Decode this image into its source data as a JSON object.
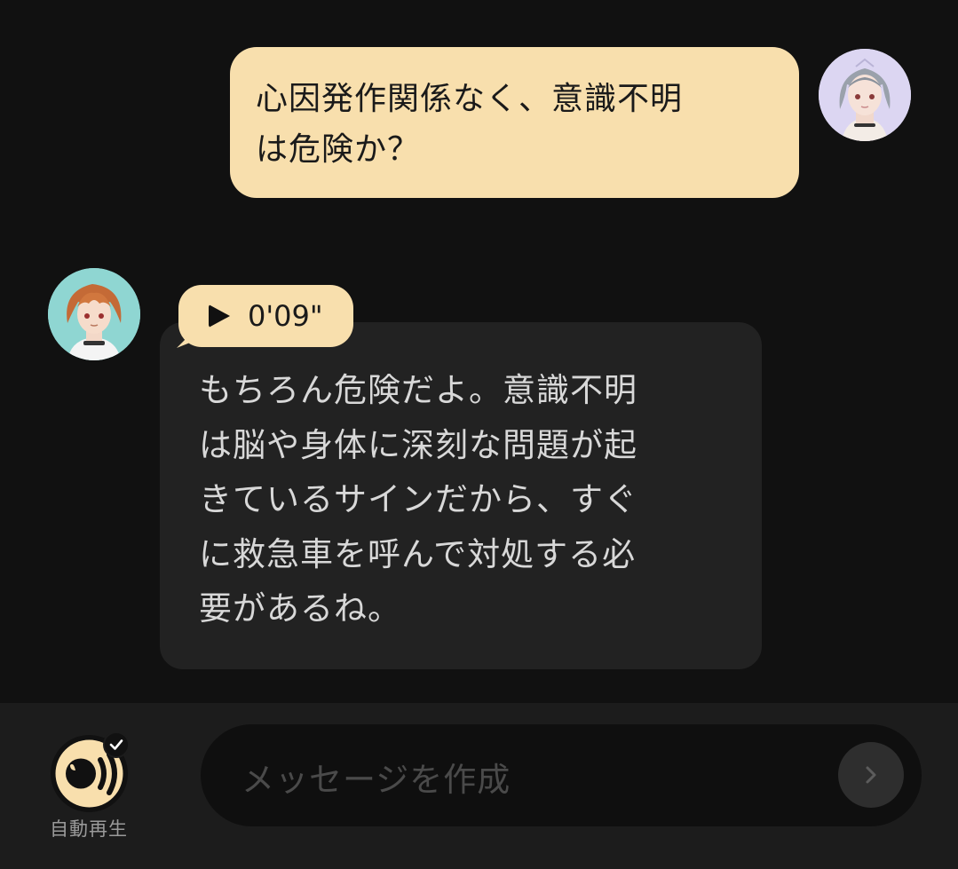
{
  "user_message": {
    "lines": [
      "心因発作関係なく、意識不明",
      "は危険か？"
    ]
  },
  "bot_message": {
    "voice_duration": "0'09\"",
    "lines": [
      "もちろん危険だよ。意識不明",
      "は脳や身体に深刻な問題が起",
      "きているサインだから、すぐ",
      "に救急車を呼んで対処する必",
      "要があるね。"
    ]
  },
  "bottom_bar": {
    "autoplay_label": "自動再生",
    "input_placeholder": "メッセージを作成"
  },
  "icons": {
    "play": "play-icon",
    "send": "chevron-right-icon",
    "autoplay": "speaker-icon",
    "autoplay_check": "check-icon"
  },
  "colors": {
    "background": "#111111",
    "user_bubble": "#f8dfad",
    "bot_bubble": "#222222",
    "bottom_bar": "#1c1c1c"
  }
}
